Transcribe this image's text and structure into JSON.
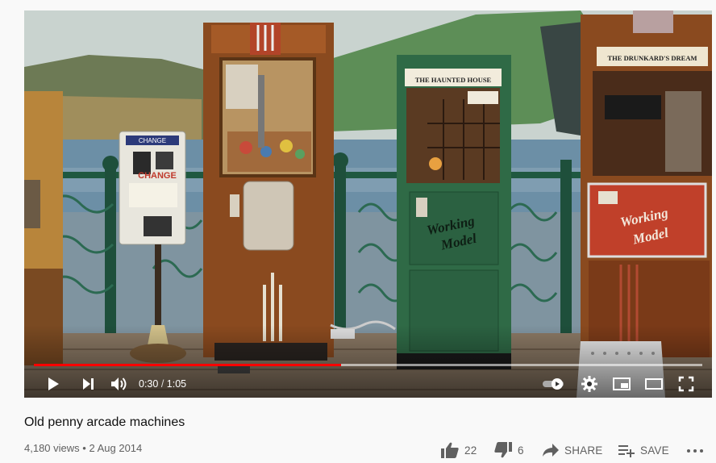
{
  "player": {
    "current_time": "0:30",
    "duration": "1:05",
    "progress_fraction": 0.46,
    "loaded_fraction": 1.0,
    "scene_labels": {
      "change_machine_top": "CHANGE",
      "change_machine_sign": "CHANGE",
      "haunted_house_sign": "THE HAUNTED HOUSE",
      "drunkards_dream_sign": "THE DRUNKARD'S DREAM",
      "green_door_text_1": "Working",
      "green_door_text_2": "Model",
      "red_panel_text_1": "Working",
      "red_panel_text_2": "Model"
    }
  },
  "video": {
    "title": "Old penny arcade machines",
    "views": "4,180 views",
    "separator": "•",
    "date": "2 Aug 2014"
  },
  "actions": {
    "like_count": "22",
    "dislike_count": "6",
    "share_label": "SHARE",
    "save_label": "SAVE"
  },
  "colors": {
    "progress_played": "#ff0000",
    "text_primary": "#111111",
    "text_secondary": "#606060",
    "page_bg": "#f9f9f9"
  }
}
